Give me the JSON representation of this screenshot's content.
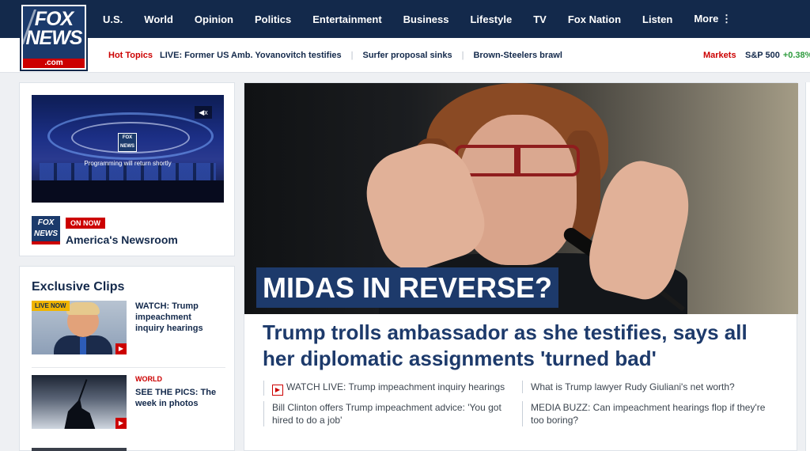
{
  "logo": {
    "text": "FOX NEWS",
    "domain": ".com"
  },
  "nav": [
    "U.S.",
    "World",
    "Opinion",
    "Politics",
    "Entertainment",
    "Business",
    "Lifestyle",
    "TV",
    "Fox Nation",
    "Listen",
    "More ⋮"
  ],
  "hot_topics": {
    "label": "Hot Topics",
    "items": [
      "LIVE: Former US Amb. Yovanovitch testifies",
      "Surfer proposal sinks",
      "Brown-Steelers brawl"
    ]
  },
  "markets": {
    "label": "Markets",
    "index": "S&P 500",
    "change": "+0.38%"
  },
  "live_player": {
    "status_text": "Programming will return shortly",
    "mute_icon": "mute-icon",
    "badge": "ON NOW",
    "show": "America's Newsroom",
    "channel_logo": "FOX NEWS channel"
  },
  "exclusive_clips": {
    "heading": "Exclusive Clips",
    "items": [
      {
        "badge": "LIVE NOW",
        "kicker": "",
        "title": "WATCH: Trump impeachment inquiry hearings"
      },
      {
        "badge": "",
        "kicker": "WORLD",
        "title": "SEE THE PICS: The week in photos"
      }
    ]
  },
  "hero": {
    "overlay": "MIDAS IN REVERSE?",
    "headline": "Trump trolls ambassador as she testifies, says all her diplomatic assignments 'turned bad'"
  },
  "related": [
    {
      "text": "WATCH LIVE: Trump impeachment inquiry hearings",
      "video": true
    },
    {
      "text": "Bill Clinton offers Trump impeachment advice: 'You got hired to do a job'",
      "video": false
    },
    {
      "text": "What is Trump lawyer Rudy Giuliani's net worth?",
      "video": false
    },
    {
      "text": "MEDIA BUZZ: Can impeachment hearings flop if they're too boring?",
      "video": false
    }
  ],
  "colors": {
    "navy": "#13294b",
    "headline_blue": "#1d3a6b",
    "red": "#cc0000",
    "green": "#2e9c3e",
    "live_yellow": "#f0b400"
  }
}
